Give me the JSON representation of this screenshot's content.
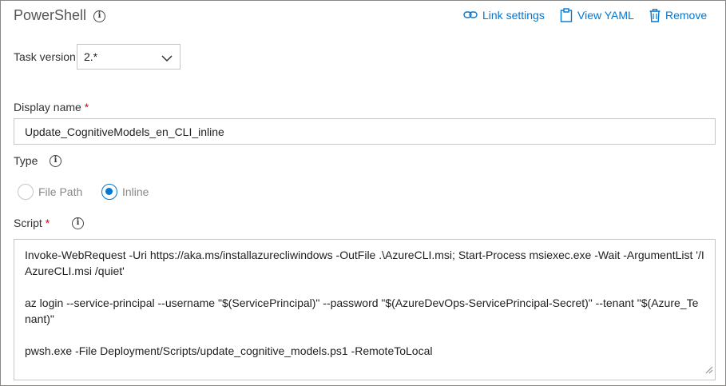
{
  "header": {
    "title": "PowerShell",
    "actions": [
      {
        "label": "Link settings",
        "icon": "link-icon"
      },
      {
        "label": "View YAML",
        "icon": "clipboard-icon"
      },
      {
        "label": "Remove",
        "icon": "trash-icon"
      }
    ]
  },
  "task_version": {
    "label": "Task version",
    "value": "2.*"
  },
  "display_name": {
    "label": "Display name",
    "required_mark": "*",
    "value": "Update_CognitiveModels_en_CLI_inline"
  },
  "type": {
    "label": "Type",
    "options": [
      {
        "label": "File Path",
        "selected": false
      },
      {
        "label": "Inline",
        "selected": true
      }
    ]
  },
  "script": {
    "label": "Script",
    "required_mark": "*",
    "lines": [
      "Invoke-WebRequest -Uri https://aka.ms/installazurecliwindows -OutFile .\\AzureCLI.msi; Start-Process msiexec.exe -Wait -ArgumentList '/I AzureCLI.msi /quiet'",
      "az login --service-principal --username \"$(ServicePrincipal)\" --password \"$(AzureDevOps-ServicePrincipal-Secret)\" --tenant \"$(Azure_Tenant)\"",
      "pwsh.exe -File Deployment/Scripts/update_cognitive_models.ps1 -RemoteToLocal"
    ]
  },
  "colors": {
    "accent": "#0078d4",
    "required": "#c50f1f",
    "border": "#c8c6c4"
  }
}
